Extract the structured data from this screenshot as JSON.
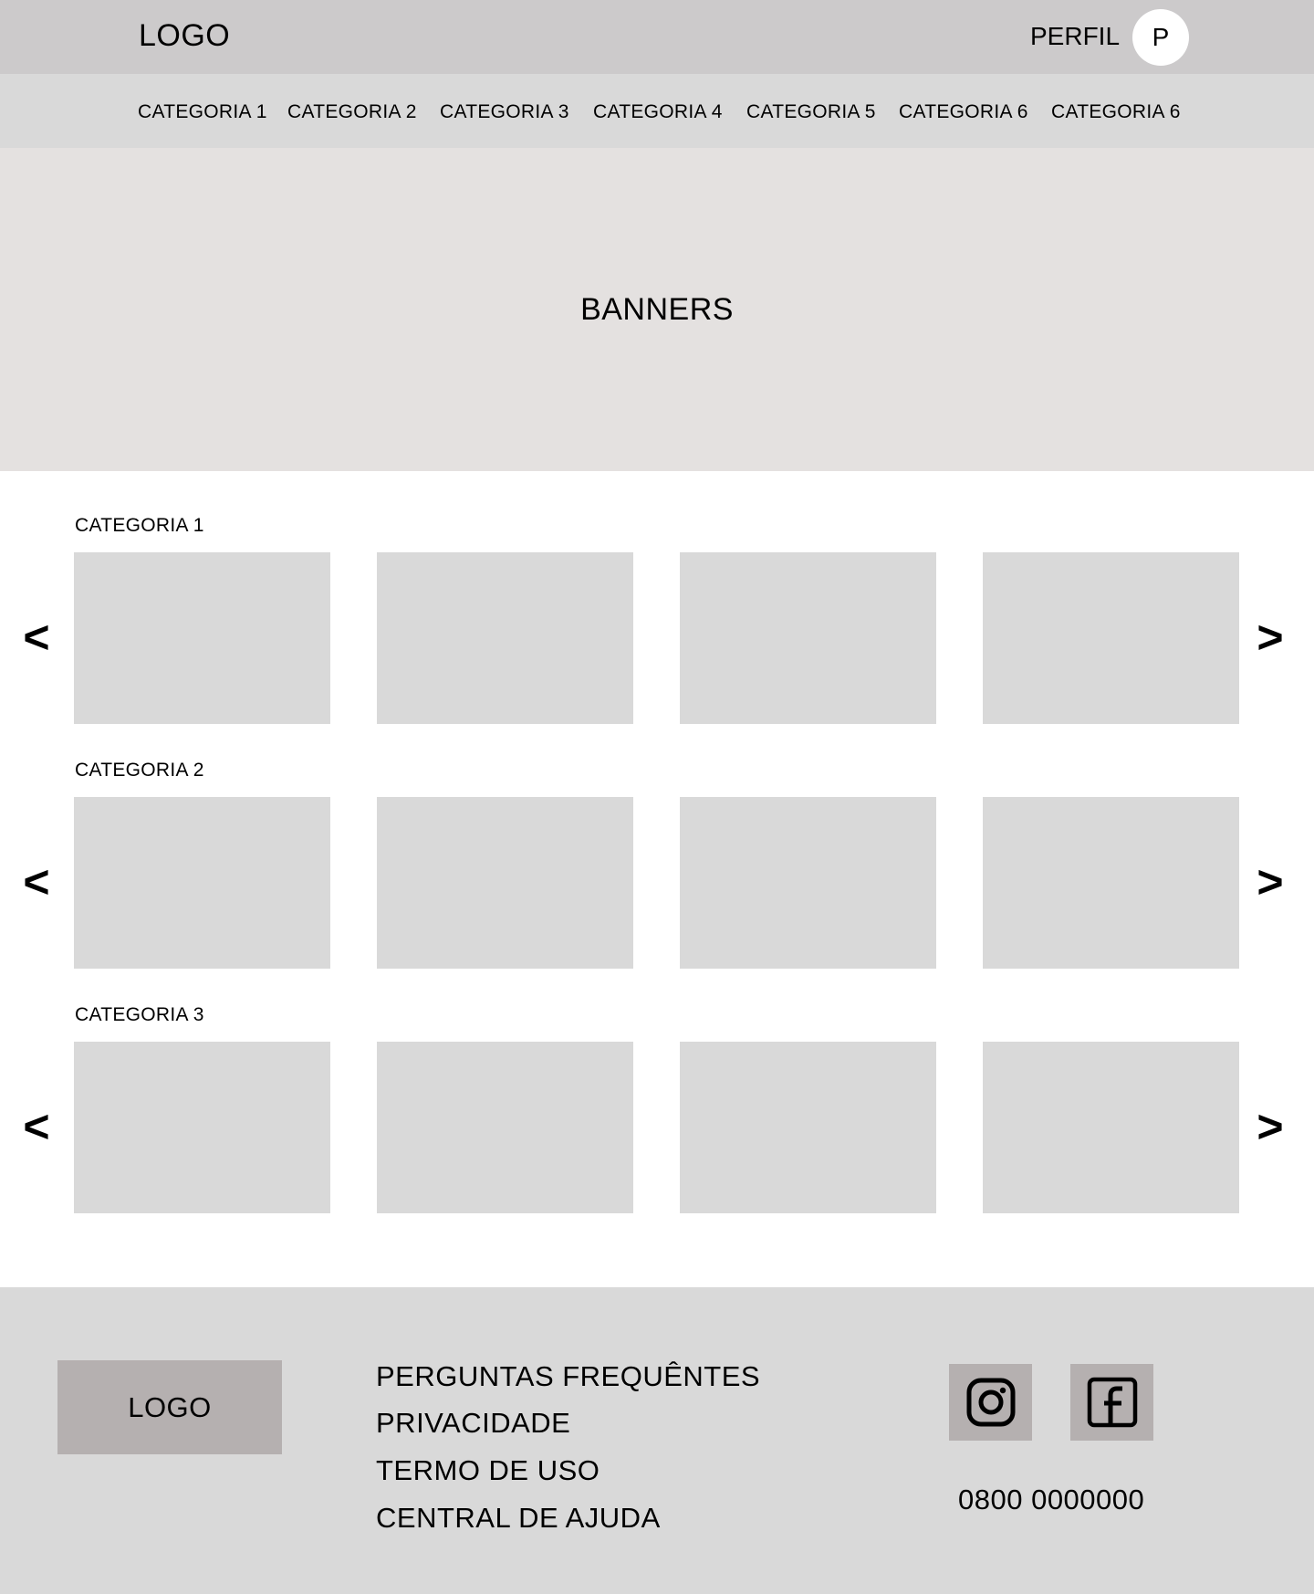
{
  "header": {
    "logo": "LOGO",
    "profile_label": "PERFIL",
    "avatar_initial": "P"
  },
  "category_nav": [
    "CATEGORIA 1",
    "CATEGORIA 2",
    "CATEGORIA 3",
    "CATEGORIA 4",
    "CATEGORIA 5",
    "CATEGORIA 6",
    "CATEGORIA 6"
  ],
  "banner": {
    "label": "BANNERS"
  },
  "sections": [
    {
      "title": "CATEGORIA 1",
      "prev": "<",
      "next": ">"
    },
    {
      "title": "CATEGORIA 2",
      "prev": "<",
      "next": ">"
    },
    {
      "title": "CATEGORIA 3",
      "prev": "<",
      "next": ">"
    }
  ],
  "footer": {
    "logo": "LOGO",
    "links": [
      "PERGUNTAS FREQUÊNTES",
      "PRIVACIDADE",
      "TERMO DE USO",
      "CENTRAL DE AJUDA"
    ],
    "social_icons": [
      "instagram-icon",
      "facebook-icon"
    ],
    "phone": "0800 0000000"
  },
  "colors": {
    "header_bg": "#cccacb",
    "nav_bg": "#d9d9d9",
    "banner_bg": "#e4e1e0",
    "card_bg": "#d9d9d9",
    "footer_bg": "#d9d9d9",
    "footer_box_bg": "#b5b0b0"
  }
}
